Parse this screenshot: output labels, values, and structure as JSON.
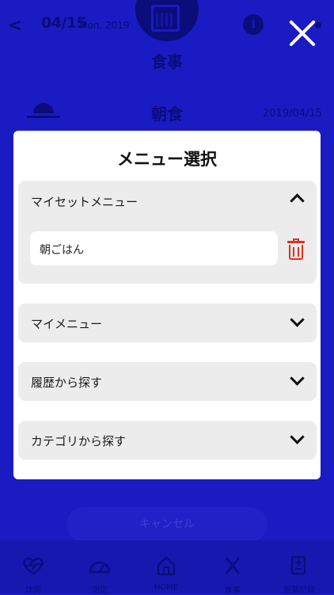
{
  "header": {
    "date": "04/15",
    "weekday": "Mon. 2019",
    "title": "食事",
    "info_symbol": "i"
  },
  "meal": {
    "name": "朝食",
    "date": "2019/04/15"
  },
  "background_button": {
    "label": "キャンセル"
  },
  "tabbar": {
    "tabs": [
      {
        "label": "体調",
        "icon": "heart-pulse-icon"
      },
      {
        "label": "測定",
        "icon": "gauge-icon"
      },
      {
        "label": "HOME",
        "icon": "home-icon"
      },
      {
        "label": "食事",
        "icon": "utensils-icon"
      },
      {
        "label": "服薬記録",
        "icon": "medicine-record-icon"
      }
    ]
  },
  "modal": {
    "title": "メニュー選択",
    "sections": [
      {
        "label": "マイセットメニュー",
        "expanded": true,
        "items": [
          {
            "text": "朝ごはん"
          }
        ]
      },
      {
        "label": "マイメニュー",
        "expanded": false
      },
      {
        "label": "履歴から探す",
        "expanded": false
      },
      {
        "label": "カテゴリから探す",
        "expanded": false
      }
    ]
  },
  "colors": {
    "background": "#1a1bc2",
    "dim_text": "#0b0d7a",
    "modal": "#ffffff",
    "section": "#ececec",
    "delete": "#e0301e"
  }
}
